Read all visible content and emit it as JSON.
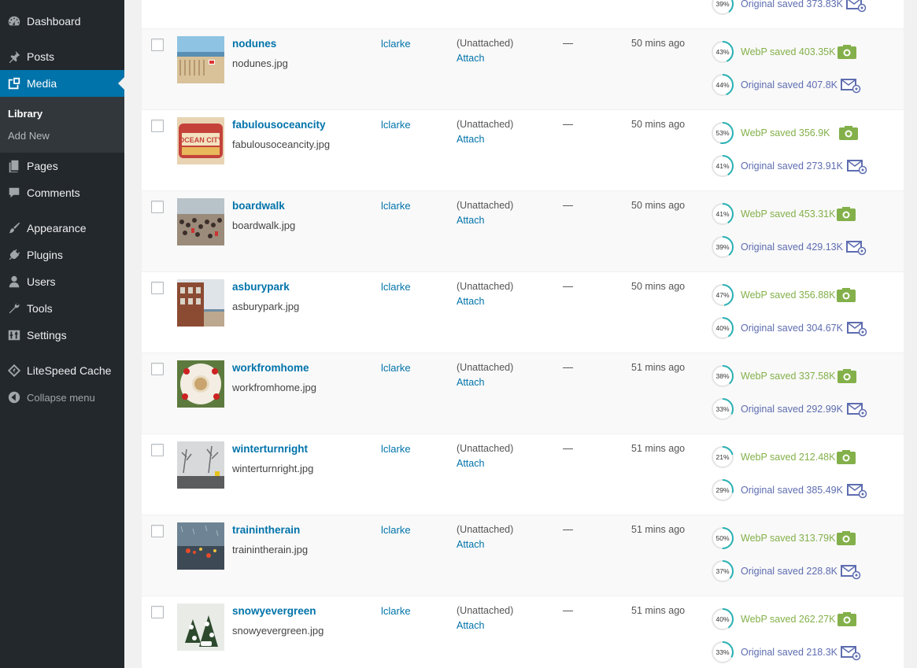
{
  "sidebar": {
    "dashboard": "Dashboard",
    "posts": "Posts",
    "media": "Media",
    "library": "Library",
    "add_new": "Add New",
    "pages": "Pages",
    "comments": "Comments",
    "appearance": "Appearance",
    "plugins": "Plugins",
    "users": "Users",
    "tools": "Tools",
    "settings": "Settings",
    "litespeed": "LiteSpeed Cache",
    "collapse": "Collapse menu"
  },
  "top_partial": {
    "pct": "39%",
    "original_label": "Original saved 373.83K"
  },
  "media_rows": [
    {
      "title": "nodunes",
      "file": "nodunes.jpg",
      "author": "lclarke",
      "attached": "(Unattached)",
      "attach": "Attach",
      "comments": "—",
      "date": "50 mins ago",
      "webp_pct": "43%",
      "webp_label": "WebP saved 403.35K",
      "orig_pct": "44%",
      "orig_label": "Original saved 407.8K",
      "thumb": "beach"
    },
    {
      "title": "fabulousoceancity",
      "file": "fabulousoceancity.jpg",
      "author": "lclarke",
      "attached": "(Unattached)",
      "attach": "Attach",
      "comments": "—",
      "date": "50 mins ago",
      "webp_pct": "53%",
      "webp_label": "WebP saved 356.9K",
      "orig_pct": "41%",
      "orig_label": "Original saved 273.91K",
      "thumb": "sign"
    },
    {
      "title": "boardwalk",
      "file": "boardwalk.jpg",
      "author": "lclarke",
      "attached": "(Unattached)",
      "attach": "Attach",
      "comments": "—",
      "date": "50 mins ago",
      "webp_pct": "41%",
      "webp_label": "WebP saved 453.31K",
      "orig_pct": "39%",
      "orig_label": "Original saved 429.13K",
      "thumb": "crowd"
    },
    {
      "title": "asburypark",
      "file": "asburypark.jpg",
      "author": "lclarke",
      "attached": "(Unattached)",
      "attach": "Attach",
      "comments": "—",
      "date": "50 mins ago",
      "webp_pct": "47%",
      "webp_label": "WebP saved 356.88K",
      "orig_pct": "40%",
      "orig_label": "Original saved 304.67K",
      "thumb": "building"
    },
    {
      "title": "workfromhome",
      "file": "workfromhome.jpg",
      "author": "lclarke",
      "attached": "(Unattached)",
      "attach": "Attach",
      "comments": "—",
      "date": "51 mins ago",
      "webp_pct": "38%",
      "webp_label": "WebP saved 337.58K",
      "orig_pct": "33%",
      "orig_label": "Original saved 292.99K",
      "thumb": "coffee"
    },
    {
      "title": "winterturnright",
      "file": "winterturnright.jpg",
      "author": "lclarke",
      "attached": "(Unattached)",
      "attach": "Attach",
      "comments": "—",
      "date": "51 mins ago",
      "webp_pct": "21%",
      "webp_label": "WebP saved 212.48K",
      "orig_pct": "29%",
      "orig_label": "Original saved 385.49K",
      "thumb": "winter"
    },
    {
      "title": "trainintherain",
      "file": "trainintherain.jpg",
      "author": "lclarke",
      "attached": "(Unattached)",
      "attach": "Attach",
      "comments": "—",
      "date": "51 mins ago",
      "webp_pct": "50%",
      "webp_label": "WebP saved 313.79K",
      "orig_pct": "37%",
      "orig_label": "Original saved 228.8K",
      "thumb": "rain"
    },
    {
      "title": "snowyevergreen",
      "file": "snowyevergreen.jpg",
      "author": "lclarke",
      "attached": "(Unattached)",
      "attach": "Attach",
      "comments": "—",
      "date": "51 mins ago",
      "webp_pct": "40%",
      "webp_label": "WebP saved 262.27K",
      "orig_pct": "33%",
      "orig_label": "Original saved 218.3K",
      "thumb": "evergreen"
    }
  ],
  "colors": {
    "sidebar_bg": "#23282d",
    "active_menu": "#0073aa",
    "link": "#0073aa",
    "webp_green": "#83b04a",
    "original_purple": "#5e6db0",
    "ring_teal": "#29b1b4"
  },
  "icons": {
    "dashboard": "dashboard-icon",
    "posts": "pushpin-icon",
    "media": "media-icon",
    "pages": "pages-icon",
    "comments": "comment-icon",
    "appearance": "paintbrush-icon",
    "plugins": "plugin-icon",
    "users": "user-icon",
    "tools": "wrench-icon",
    "settings": "settings-icon",
    "litespeed": "litespeed-diamond-icon",
    "collapse": "collapse-arrow-icon",
    "webp": "camera-icon",
    "original": "image-envelope-icon"
  }
}
